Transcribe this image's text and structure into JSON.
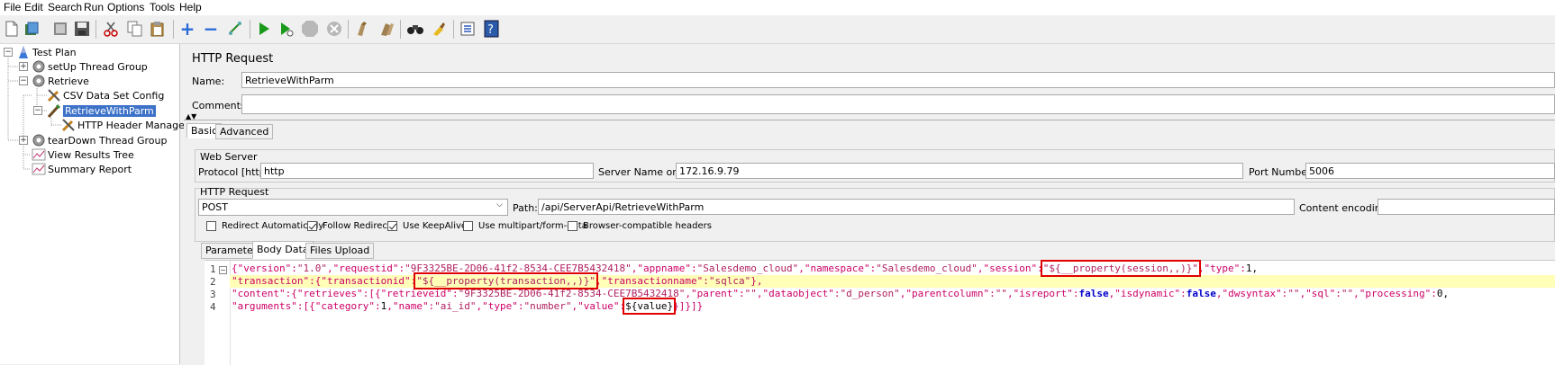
{
  "menu": [
    "File",
    "Edit",
    "Search",
    "Run",
    "Options",
    "Tools",
    "Help"
  ],
  "toolbar_icons": [
    "new-icon",
    "templates-icon",
    "open-icon",
    "save-icon",
    "cut-icon",
    "copy-icon",
    "paste-icon",
    "expand-icon",
    "collapse-icon",
    "toggle-icon",
    "start-icon",
    "start-no-pause-icon",
    "stop-icon",
    "shutdown-icon",
    "clear-icon",
    "clear-all-icon",
    "search-icon",
    "reset-search-icon",
    "function-helper-icon",
    "help-icon"
  ],
  "tree": [
    {
      "label": "Test Plan"
    },
    {
      "label": "setUp Thread Group"
    },
    {
      "label": "Retrieve"
    },
    {
      "label": "CSV Data Set Config"
    },
    {
      "label": "RetrieveWithParm"
    },
    {
      "label": "HTTP Header Manager"
    },
    {
      "label": "tearDown Thread Group"
    },
    {
      "label": "View Results Tree"
    },
    {
      "label": "Summary Report"
    }
  ],
  "panel": {
    "title": "HTTP Request",
    "name_label": "Name:",
    "name_value": "RetrieveWithParm",
    "comments_label": "Comments:",
    "comments_value": "",
    "tabs": [
      "Basic",
      "Advanced"
    ],
    "web_server": {
      "legend": "Web Server",
      "protocol_label": "Protocol [http]:",
      "protocol_value": "http",
      "server_label": "Server Name or IP:",
      "server_value": "172.16.9.79",
      "port_label": "Port Number:",
      "port_value": "5006"
    },
    "http_request": {
      "legend": "HTTP Request",
      "method": "POST",
      "path_label": "Path:",
      "path_value": "/api/ServerApi/RetrieveWithParm",
      "encoding_label": "Content encoding:",
      "encoding_value": ""
    },
    "checkboxes": [
      {
        "label": "Redirect Automatically",
        "checked": false
      },
      {
        "label": "Follow Redirects",
        "checked": true
      },
      {
        "label": "Use KeepAlive",
        "checked": true
      },
      {
        "label": "Use multipart/form-data",
        "checked": false
      },
      {
        "label": "Browser-compatible headers",
        "checked": false
      }
    ],
    "body_tabs": [
      "Parameters",
      "Body Data",
      "Files Upload"
    ]
  },
  "editor": {
    "line_numbers": [
      "1",
      "2",
      "3",
      "4"
    ],
    "l1": [
      "{\"version\":",
      "\"1.0\"",
      ",\"requestid\":",
      "\"9F3325BE-2D06-41f2-8534-CEE7B5432418\"",
      ",\"appname\":",
      "\"Salesdemo_cloud\"",
      ",\"namespace\":",
      "\"Salesdemo_cloud\"",
      ",\"session\":",
      "\"${__property(session,,)}\"",
      ",\"type\":",
      "1,"
    ],
    "l2": [
      "\"transaction\":{\"transactionid\":",
      "\"${__property(transaction,,)}\"",
      ",\"transactionname\":",
      "\"sqlca\"",
      "},"
    ],
    "l3": [
      "\"content\":{\"retrieves\":[{\"retrieveid\":",
      "\"9F3325BE-2D06-41f2-8534-CEE7B5432418\"",
      ",\"parent\":",
      "\"\"",
      ",\"dataobject\":",
      "\"d_person\"",
      ",\"parentcolumn\":",
      "\"\"",
      ",\"isreport\":",
      "false",
      ",\"isdynamic\":",
      "false",
      ",\"dwsyntax\":",
      "\"\"",
      ",\"sql\":",
      "\"\"",
      ",\"processing\":",
      "0,"
    ],
    "l4": [
      "\"arguments\":[{\"category\":",
      "1",
      ",\"name\":",
      "\"ai_id\"",
      ",\"type\":",
      "\"number\"",
      ",\"value\":",
      "${value}",
      "}]}]}"
    ]
  }
}
